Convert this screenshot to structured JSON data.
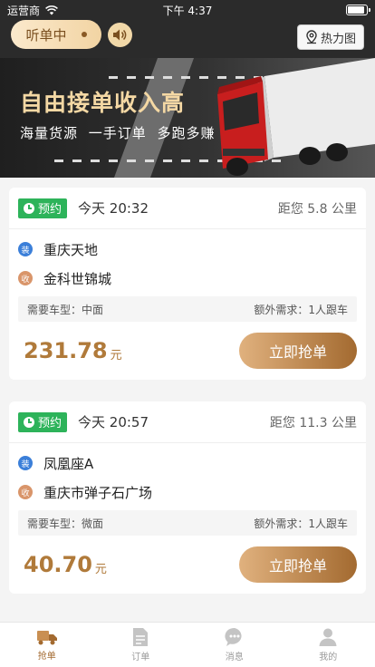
{
  "status_bar": {
    "carrier": "运营商",
    "time": "下午 4:37",
    "battery_level": 0.92
  },
  "header": {
    "listen_label": "听单中",
    "heatmap_label": "热力图"
  },
  "banner": {
    "title": "自由接单收入高",
    "subtitle": "海量货源 一手订单 多跑多赚"
  },
  "orders": [
    {
      "tag": "预约",
      "time": "今天 20:32",
      "distance": "距您 5.8 公里",
      "load_badge": "装",
      "load_address": "重庆天地",
      "unload_badge": "收",
      "unload_address": "金科世锦城",
      "vehicle": "需要车型：中面",
      "extra": "额外需求：1人跟车",
      "price": "231.78",
      "unit": "元",
      "button": "立即抢单"
    },
    {
      "tag": "预约",
      "time": "今天 20:57",
      "distance": "距您 11.3 公里",
      "load_badge": "装",
      "load_address": "凤凰座A",
      "unload_badge": "收",
      "unload_address": "重庆市弹子石广场",
      "vehicle": "需要车型：微面",
      "extra": "额外需求：1人跟车",
      "price": "40.70",
      "unit": "元",
      "button": "立即抢单"
    }
  ],
  "tabs": [
    {
      "label": "抢单",
      "icon": "truck-icon",
      "active": true
    },
    {
      "label": "订单",
      "icon": "document-icon",
      "active": false
    },
    {
      "label": "消息",
      "icon": "chat-icon",
      "active": false
    },
    {
      "label": "我的",
      "icon": "person-icon",
      "active": false
    }
  ],
  "colors": {
    "accent": "#a36a30",
    "tag_green": "#2db35a",
    "price": "#b07a3a"
  }
}
